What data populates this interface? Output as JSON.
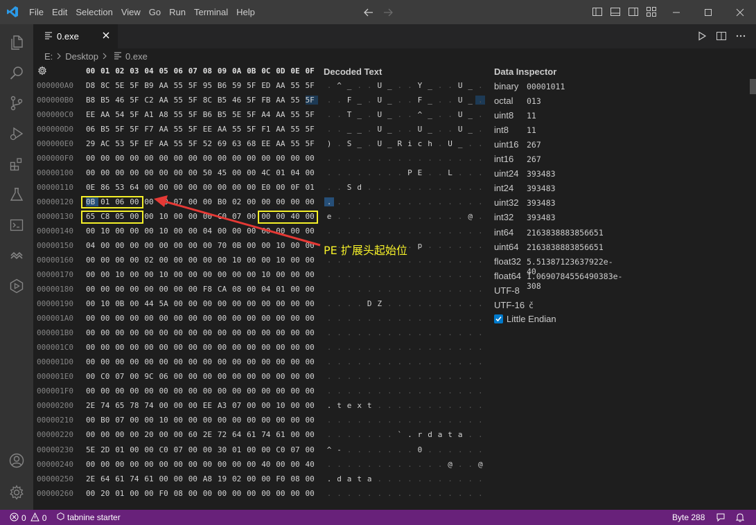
{
  "menu": [
    "File",
    "Edit",
    "Selection",
    "View",
    "Go",
    "Run",
    "Terminal",
    "Help"
  ],
  "tab": {
    "filename": "0.exe"
  },
  "breadcrumb": {
    "drive": "E:",
    "folder": "Desktop",
    "file": "0.exe"
  },
  "hex": {
    "header": [
      "00",
      "01",
      "02",
      "03",
      "04",
      "05",
      "06",
      "07",
      "08",
      "09",
      "0A",
      "0B",
      "0C",
      "0D",
      "0E",
      "0F"
    ],
    "rows": [
      {
        "addr": "000000A0",
        "bytes": "D8 8C 5E 5F B9 AA 55 5F 95 B6 59 5F ED AA 55 5F",
        "decoded": [
          [
            1,
            "^"
          ],
          [
            2,
            "_"
          ],
          [
            5,
            "U"
          ],
          [
            6,
            "_"
          ],
          [
            9,
            "Y"
          ],
          [
            10,
            "_"
          ],
          [
            13,
            "U"
          ],
          [
            14,
            "_"
          ]
        ]
      },
      {
        "addr": "000000B0",
        "bytes": "B8 B5 46 5F C2 AA 55 5F 8C B5 46 5F FB AA 55 5F",
        "decoded": [
          [
            2,
            "F"
          ],
          [
            3,
            "_"
          ],
          [
            5,
            "U"
          ],
          [
            6,
            "_"
          ],
          [
            9,
            "F"
          ],
          [
            10,
            "_"
          ],
          [
            13,
            "U"
          ],
          [
            14,
            "_"
          ]
        ]
      },
      {
        "addr": "000000C0",
        "bytes": "EE AA 54 5F A1 A8 55 5F B6 B5 5E 5F A4 AA 55 5F",
        "decoded": [
          [
            2,
            "T"
          ],
          [
            3,
            "_"
          ],
          [
            5,
            "U"
          ],
          [
            6,
            "_"
          ],
          [
            9,
            "^"
          ],
          [
            10,
            "_"
          ],
          [
            13,
            "U"
          ],
          [
            14,
            "_"
          ]
        ]
      },
      {
        "addr": "000000D0",
        "bytes": "06 B5 5F 5F F7 AA 55 5F EE AA 55 5F F1 AA 55 5F",
        "decoded": [
          [
            2,
            "_"
          ],
          [
            3,
            "_"
          ],
          [
            5,
            "U"
          ],
          [
            6,
            "_"
          ],
          [
            9,
            "U"
          ],
          [
            10,
            "_"
          ],
          [
            13,
            "U"
          ],
          [
            14,
            "_"
          ]
        ]
      },
      {
        "addr": "000000E0",
        "bytes": "29 AC 53 5F EF AA 55 5F 52 69 63 68 EE AA 55 5F",
        "decoded": [
          [
            0,
            ")"
          ],
          [
            2,
            "S"
          ],
          [
            3,
            "_"
          ],
          [
            5,
            "U"
          ],
          [
            6,
            "_"
          ],
          [
            7,
            "R"
          ],
          [
            8,
            "i"
          ],
          [
            9,
            "c"
          ],
          [
            10,
            "h"
          ],
          [
            12,
            "U"
          ],
          [
            13,
            "_"
          ]
        ]
      },
      {
        "addr": "000000F0",
        "bytes": "00 00 00 00 00 00 00 00 00 00 00 00 00 00 00 00",
        "decoded": []
      },
      {
        "addr": "00000100",
        "bytes": "00 00 00 00 00 00 00 00 50 45 00 00 4C 01 04 00",
        "decoded": [
          [
            8,
            "P"
          ],
          [
            9,
            "E"
          ],
          [
            12,
            "L"
          ]
        ]
      },
      {
        "addr": "00000110",
        "bytes": "0E 86 53 64 00 00 00 00 00 00 00 00 E0 00 0F 01",
        "decoded": [
          [
            2,
            "S"
          ],
          [
            3,
            "d"
          ]
        ]
      },
      {
        "addr": "00000120",
        "bytes": "0B 01 06 00 00 00 07 00 00 B0 02 00 00 00 00 00",
        "decoded": [
          [
            0,
            "."
          ]
        ]
      },
      {
        "addr": "00000130",
        "bytes": "65 C8 05 00 00 10 00 00 00 C0 07 00 00 00 40 00",
        "decoded": [
          [
            0,
            "e"
          ],
          [
            14,
            "@"
          ]
        ]
      },
      {
        "addr": "00000140",
        "bytes": "00 10 00 00 00 10 00 00 04 00 00 00 00 00 00 00",
        "decoded": []
      },
      {
        "addr": "00000150",
        "bytes": "04 00 00 00 00 00 00 00 00 70 0B 00 00 10 00 00",
        "decoded": [
          [
            9,
            "p"
          ]
        ]
      },
      {
        "addr": "00000160",
        "bytes": "00 00 00 00 02 00 00 00 00 00 10 00 00 10 00 00",
        "decoded": []
      },
      {
        "addr": "00000170",
        "bytes": "00 00 10 00 00 10 00 00 00 00 00 00 10 00 00 00",
        "decoded": []
      },
      {
        "addr": "00000180",
        "bytes": "00 00 00 00 00 00 00 00 F8 CA 08 00 04 01 00 00",
        "decoded": []
      },
      {
        "addr": "00000190",
        "bytes": "00 10 0B 00 44 5A 00 00 00 00 00 00 00 00 00 00",
        "decoded": [
          [
            4,
            "D"
          ],
          [
            5,
            "Z"
          ]
        ]
      },
      {
        "addr": "000001A0",
        "bytes": "00 00 00 00 00 00 00 00 00 00 00 00 00 00 00 00",
        "decoded": []
      },
      {
        "addr": "000001B0",
        "bytes": "00 00 00 00 00 00 00 00 00 00 00 00 00 00 00 00",
        "decoded": []
      },
      {
        "addr": "000001C0",
        "bytes": "00 00 00 00 00 00 00 00 00 00 00 00 00 00 00 00",
        "decoded": []
      },
      {
        "addr": "000001D0",
        "bytes": "00 00 00 00 00 00 00 00 00 00 00 00 00 00 00 00",
        "decoded": []
      },
      {
        "addr": "000001E0",
        "bytes": "00 C0 07 00 9C 06 00 00 00 00 00 00 00 00 00 00",
        "decoded": []
      },
      {
        "addr": "000001F0",
        "bytes": "00 00 00 00 00 00 00 00 00 00 00 00 00 00 00 00",
        "decoded": []
      },
      {
        "addr": "00000200",
        "bytes": "2E 74 65 78 74 00 00 00 EE A3 07 00 00 10 00 00",
        "decoded": [
          [
            0,
            "."
          ],
          [
            1,
            "t"
          ],
          [
            2,
            "e"
          ],
          [
            3,
            "x"
          ],
          [
            4,
            "t"
          ]
        ]
      },
      {
        "addr": "00000210",
        "bytes": "00 B0 07 00 00 10 00 00 00 00 00 00 00 00 00 00",
        "decoded": []
      },
      {
        "addr": "00000220",
        "bytes": "00 00 00 00 20 00 00 60 2E 72 64 61 74 61 00 00",
        "decoded": [
          [
            7,
            "`"
          ],
          [
            8,
            "."
          ],
          [
            9,
            "r"
          ],
          [
            10,
            "d"
          ],
          [
            11,
            "a"
          ],
          [
            12,
            "t"
          ],
          [
            13,
            "a"
          ]
        ]
      },
      {
        "addr": "00000230",
        "bytes": "5E 2D 01 00 00 C0 07 00 00 30 01 00 00 C0 07 00",
        "decoded": [
          [
            0,
            "^"
          ],
          [
            1,
            "-"
          ],
          [
            9,
            "0"
          ]
        ]
      },
      {
        "addr": "00000240",
        "bytes": "00 00 00 00 00 00 00 00 00 00 00 00 40 00 00 40",
        "decoded": [
          [
            12,
            "@"
          ],
          [
            15,
            "@"
          ]
        ]
      },
      {
        "addr": "00000250",
        "bytes": "2E 64 61 74 61 00 00 00 A8 19 02 00 00 F0 08 00",
        "decoded": [
          [
            0,
            "."
          ],
          [
            1,
            "d"
          ],
          [
            2,
            "a"
          ],
          [
            3,
            "t"
          ],
          [
            4,
            "a"
          ]
        ]
      },
      {
        "addr": "00000260",
        "bytes": "00 20 01 00 00 F0 08 00 00 00 00 00 00 00 00 00",
        "decoded": []
      }
    ]
  },
  "decoded_title": "Decoded Text",
  "annotation": "PE 扩展头起始位",
  "inspector": {
    "title": "Data Inspector",
    "rows": [
      [
        "binary",
        "00001011"
      ],
      [
        "octal",
        "013"
      ],
      [
        "uint8",
        "11"
      ],
      [
        "int8",
        "11"
      ],
      [
        "uint16",
        "267"
      ],
      [
        "int16",
        "267"
      ],
      [
        "uint24",
        "393483"
      ],
      [
        "int24",
        "393483"
      ],
      [
        "uint32",
        "393483"
      ],
      [
        "int32",
        "393483"
      ],
      [
        "int64",
        "2163838883856651"
      ],
      [
        "uint64",
        "2163838883856651"
      ],
      [
        "float32",
        "5.51387123637922e-40"
      ],
      [
        "float64",
        "1.0690784556490383e-308"
      ],
      [
        "UTF-8",
        ""
      ],
      [
        "UTF-16",
        "č"
      ]
    ],
    "little_endian_label": "Little Endian",
    "little_endian_checked": true
  },
  "status": {
    "errors": "0",
    "warnings": "0",
    "tabnine": "tabnine starter",
    "byte": "Byte 288"
  },
  "colors": {
    "accent": "#007acc",
    "statusbar": "#68217a",
    "highlight": "#f5f029",
    "arrow": "#e53935"
  }
}
